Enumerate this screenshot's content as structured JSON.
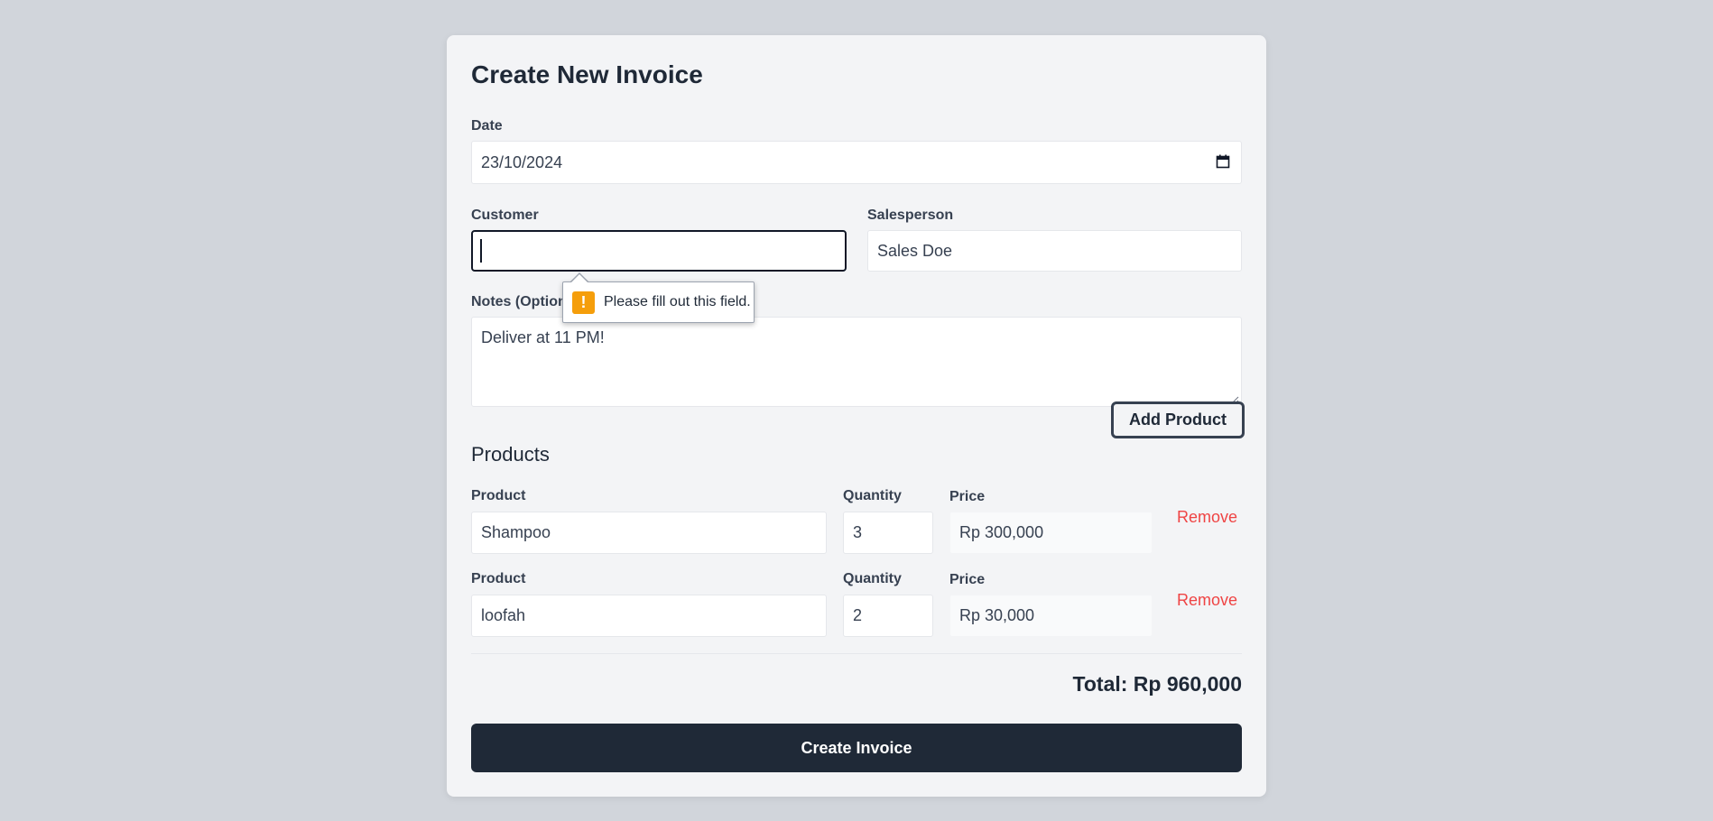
{
  "form": {
    "title": "Create New Invoice",
    "date": {
      "label": "Date",
      "value": "23/10/2024"
    },
    "customer": {
      "label": "Customer",
      "value": ""
    },
    "salesperson": {
      "label": "Salesperson",
      "value": "Sales Doe"
    },
    "notes": {
      "label": "Notes (Optional)",
      "value": "Deliver at 11 PM!"
    },
    "validation_tooltip": "Please fill out this field."
  },
  "products": {
    "title": "Products",
    "add_label": "Add Product",
    "product_label": "Product",
    "quantity_label": "Quantity",
    "price_label": "Price",
    "remove_label": "Remove",
    "rows": [
      {
        "product": "Shampoo",
        "quantity": "3",
        "price": "Rp 300,000"
      },
      {
        "product": "loofah",
        "quantity": "2",
        "price": "Rp 30,000"
      }
    ]
  },
  "summary": {
    "total": "Total: Rp 960,000"
  },
  "actions": {
    "submit_label": "Create Invoice"
  },
  "colors": {
    "accent": "#1f2937",
    "danger": "#ef4444",
    "warning": "#f59e0b",
    "background": "#d1d5db",
    "card": "#f3f4f6"
  },
  "icons": {
    "date_picker": "calendar-icon",
    "warning": "exclamation-icon"
  }
}
